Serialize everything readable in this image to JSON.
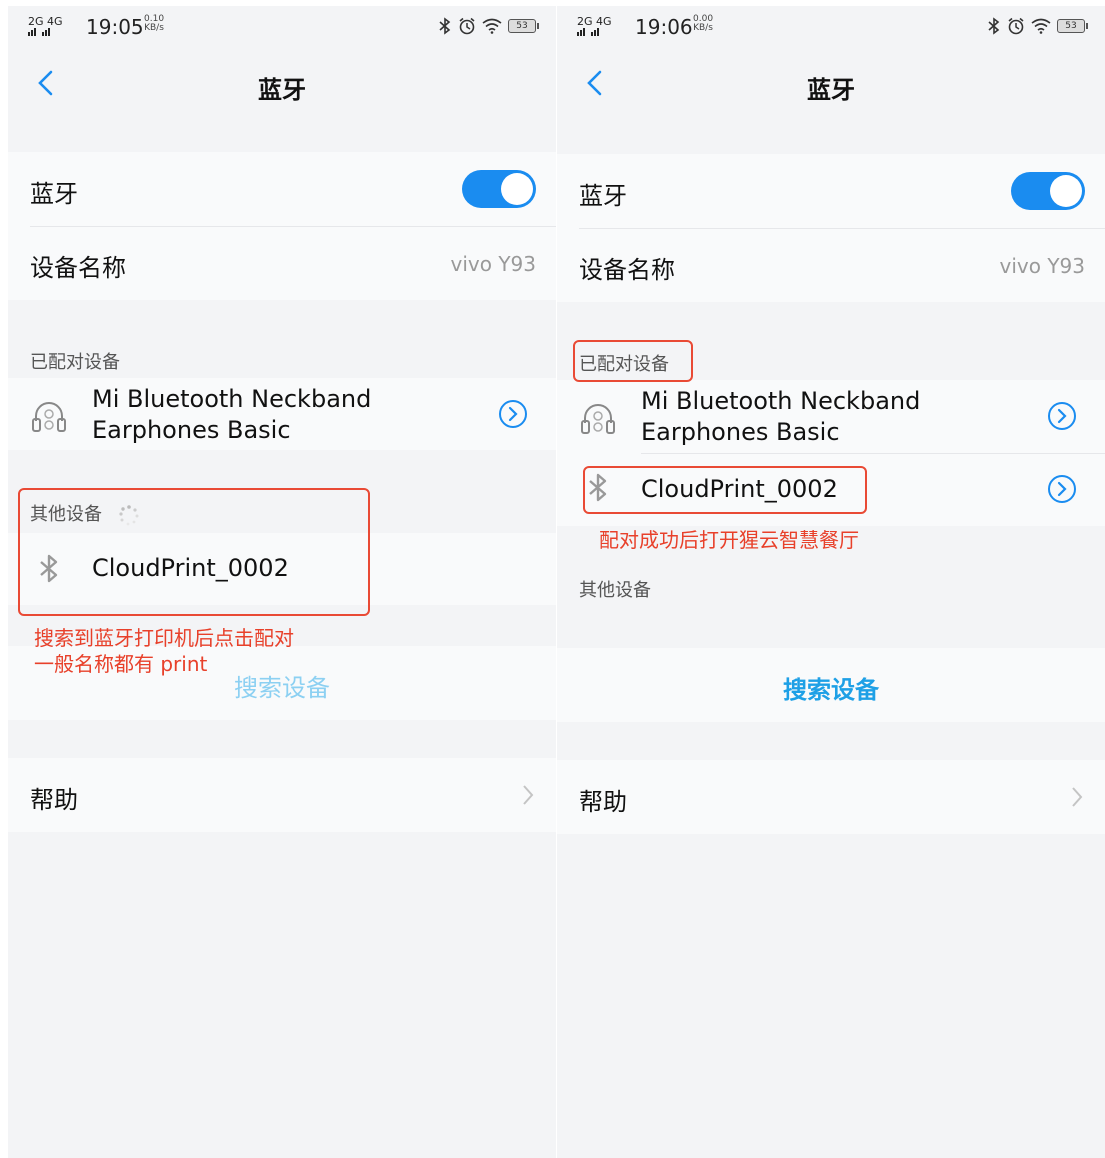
{
  "screens": [
    {
      "status": {
        "sig1": "2G",
        "sig2": "4G",
        "time": "19:05",
        "speed_value": "0.10",
        "speed_unit": "KB/s",
        "battery": "53"
      },
      "nav": {
        "title": "蓝牙"
      },
      "bluetooth_label": "蓝牙",
      "bluetooth_on": true,
      "device_name_label": "设备名称",
      "device_name_value": "vivo Y93",
      "paired_header": "已配对设备",
      "paired_devices": [
        {
          "name_line1": "Mi Bluetooth Neckband",
          "name_line2": "Earphones Basic",
          "icon": "headset-icon"
        }
      ],
      "other_header": "其他设备",
      "other_devices": [
        {
          "name": "CloudPrint_0002",
          "icon": "bluetooth-icon"
        }
      ],
      "annotation_line1": "搜索到蓝牙打印机后点击配对",
      "annotation_line2": "一般名称都有 print",
      "search_label": "搜索设备",
      "help_label": "帮助"
    },
    {
      "status": {
        "sig1": "2G",
        "sig2": "4G",
        "time": "19:06",
        "speed_value": "0.00",
        "speed_unit": "KB/s",
        "battery": "53"
      },
      "nav": {
        "title": "蓝牙"
      },
      "bluetooth_label": "蓝牙",
      "bluetooth_on": true,
      "device_name_label": "设备名称",
      "device_name_value": "vivo Y93",
      "paired_header": "已配对设备",
      "paired_devices": [
        {
          "name_line1": "Mi Bluetooth Neckband",
          "name_line2": "Earphones Basic",
          "icon": "headset-icon"
        },
        {
          "name": "CloudPrint_0002",
          "icon": "bluetooth-icon"
        }
      ],
      "annotation": "配对成功后打开猩云智慧餐厅",
      "other_header": "其他设备",
      "search_label": "搜索设备",
      "help_label": "帮助"
    }
  ],
  "colors": {
    "accent": "#1a8cf0",
    "link": "#1ea0e6",
    "annotation": "#e8402a",
    "background": "#f3f4f6"
  }
}
